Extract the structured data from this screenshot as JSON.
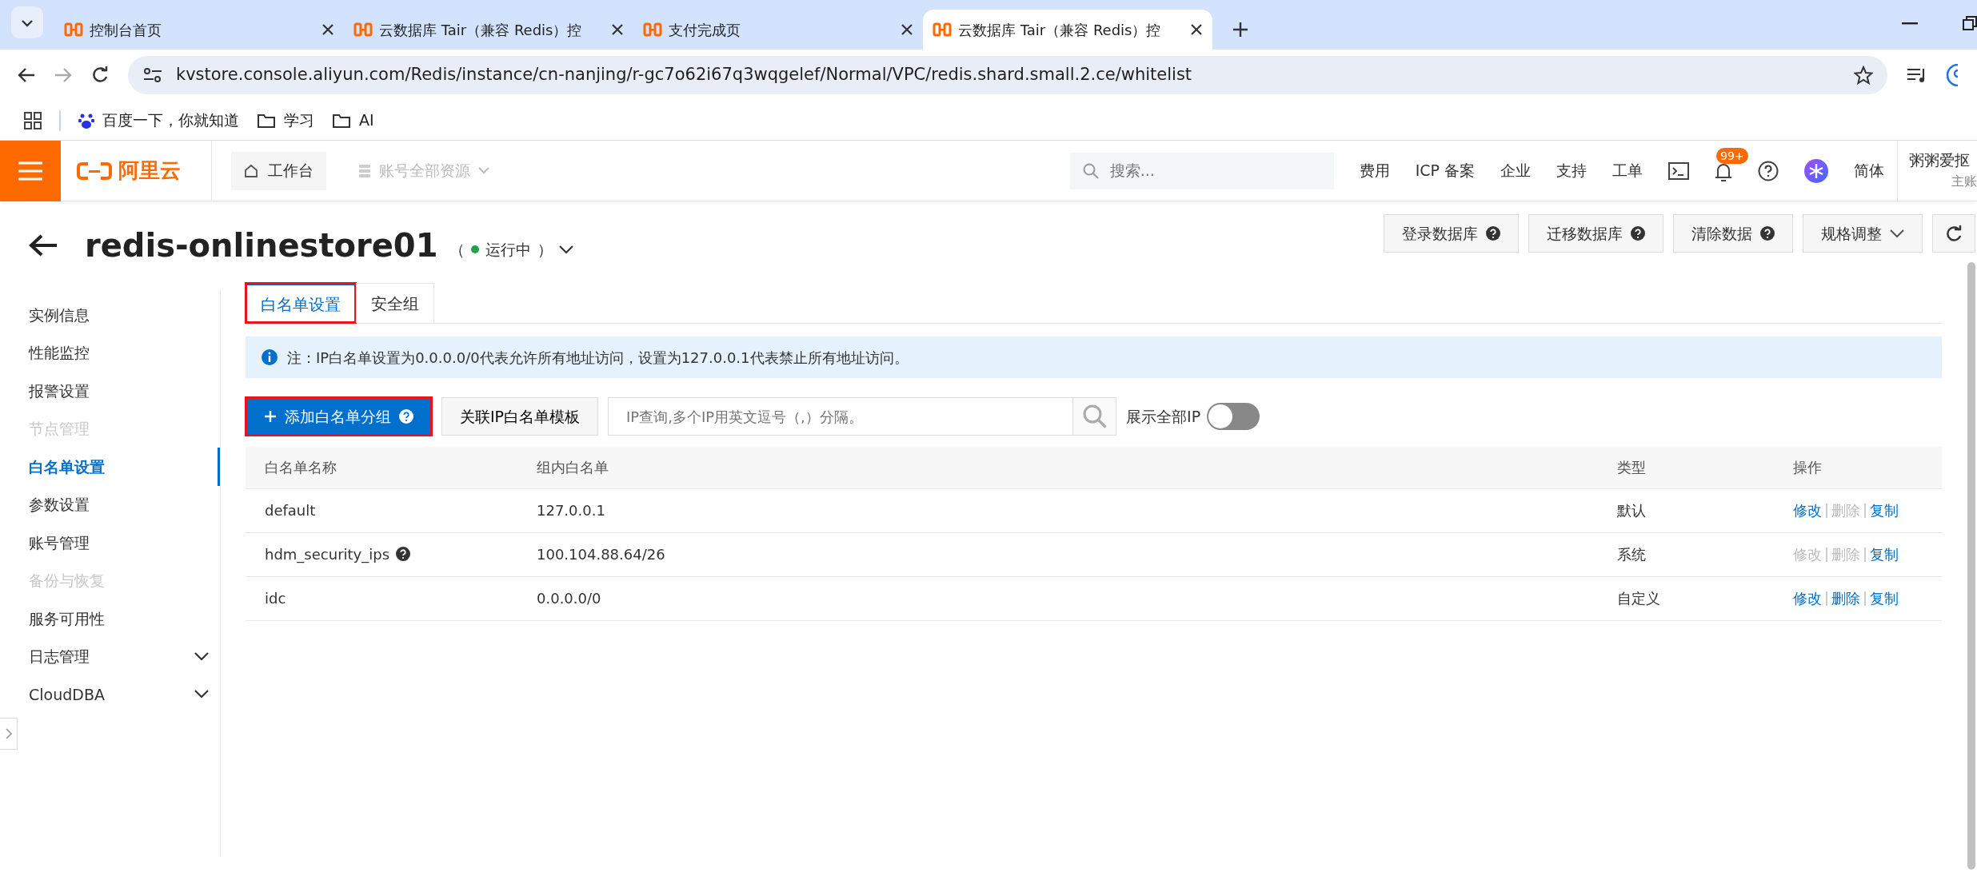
{
  "browser": {
    "tabs": [
      {
        "title": "控制台首页",
        "selected": false
      },
      {
        "title": "云数据库 Tair（兼容 Redis）控",
        "selected": false
      },
      {
        "title": "支付完成页",
        "selected": false
      },
      {
        "title": "云数据库 Tair（兼容 Redis）控",
        "selected": true
      }
    ],
    "url": "kvstore.console.aliyun.com/Redis/instance/cn-nanjing/r-gc7o62i67q3wqgelef/Normal/VPC/redis.shard.small.2.ce/whitelist",
    "bookmarks": [
      {
        "kind": "site",
        "label": "百度一下，你就知道"
      },
      {
        "kind": "folder",
        "label": "学习"
      },
      {
        "kind": "folder",
        "label": "AI"
      }
    ]
  },
  "header": {
    "logo": "阿里云",
    "workbench": "工作台",
    "resources": "账号全部资源",
    "search_placeholder": "搜索...",
    "links": [
      "费用",
      "ICP 备案",
      "企业",
      "支持",
      "工单"
    ],
    "notification_count": "99+",
    "language": "简体",
    "user_name": "粥粥爱抠",
    "user_role": "主账"
  },
  "instance": {
    "name": "redis-onlinestore01",
    "status_open": "（",
    "status": "运行中",
    "status_close": "）",
    "actions": [
      {
        "label": "登录数据库",
        "kind": "help"
      },
      {
        "label": "迁移数据库",
        "kind": "help"
      },
      {
        "label": "清除数据",
        "kind": "help"
      },
      {
        "label": "规格调整",
        "kind": "dropdown"
      },
      {
        "kind": "refresh"
      }
    ]
  },
  "sidebar": {
    "items": [
      {
        "label": "实例信息",
        "kind": "link",
        "selected": false,
        "disabled": false
      },
      {
        "label": "性能监控",
        "kind": "link",
        "selected": false,
        "disabled": false
      },
      {
        "label": "报警设置",
        "kind": "link",
        "selected": false,
        "disabled": false
      },
      {
        "label": "节点管理",
        "kind": "link",
        "selected": false,
        "disabled": true
      },
      {
        "label": "白名单设置",
        "kind": "link",
        "selected": true,
        "disabled": false
      },
      {
        "label": "参数设置",
        "kind": "link",
        "selected": false,
        "disabled": false
      },
      {
        "label": "账号管理",
        "kind": "link",
        "selected": false,
        "disabled": false
      },
      {
        "label": "备份与恢复",
        "kind": "link",
        "selected": false,
        "disabled": true
      },
      {
        "label": "服务可用性",
        "kind": "link",
        "selected": false,
        "disabled": false
      },
      {
        "label": "日志管理",
        "kind": "group",
        "selected": false,
        "disabled": false
      },
      {
        "label": "CloudDBA",
        "kind": "group",
        "selected": false,
        "disabled": false
      }
    ]
  },
  "tabs": [
    {
      "label": "白名单设置",
      "selected": true,
      "highlighted": true
    },
    {
      "label": "安全组",
      "selected": false,
      "highlighted": false
    }
  ],
  "notice": "注：IP白名单设置为0.0.0.0/0代表允许所有地址访问，设置为127.0.0.1代表禁止所有地址访问。",
  "toolbar": {
    "add_button": {
      "label": "添加白名单分组",
      "highlighted": true
    },
    "template_button": "关联IP白名单模板",
    "search_placeholder": "IP查询,多个IP用英文逗号（,）分隔。",
    "show_all_label": "展示全部IP",
    "show_all_on": false
  },
  "table": {
    "columns": [
      "白名单名称",
      "组内白名单",
      "类型",
      "操作"
    ],
    "rows": [
      {
        "name": "default",
        "help": false,
        "ips": "127.0.0.1",
        "type": "默认",
        "actions": [
          {
            "label": "修改",
            "disabled": false
          },
          {
            "label": "删除",
            "disabled": true
          },
          {
            "label": "复制",
            "disabled": false
          }
        ]
      },
      {
        "name": "hdm_security_ips",
        "help": true,
        "ips": "100.104.88.64/26",
        "type": "系统",
        "actions": [
          {
            "label": "修改",
            "disabled": true
          },
          {
            "label": "删除",
            "disabled": true
          },
          {
            "label": "复制",
            "disabled": false
          }
        ]
      },
      {
        "name": "idc",
        "help": false,
        "ips": "0.0.0.0/0",
        "type": "自定义",
        "actions": [
          {
            "label": "修改",
            "disabled": false
          },
          {
            "label": "删除",
            "disabled": false
          },
          {
            "label": "复制",
            "disabled": false
          }
        ]
      }
    ]
  }
}
